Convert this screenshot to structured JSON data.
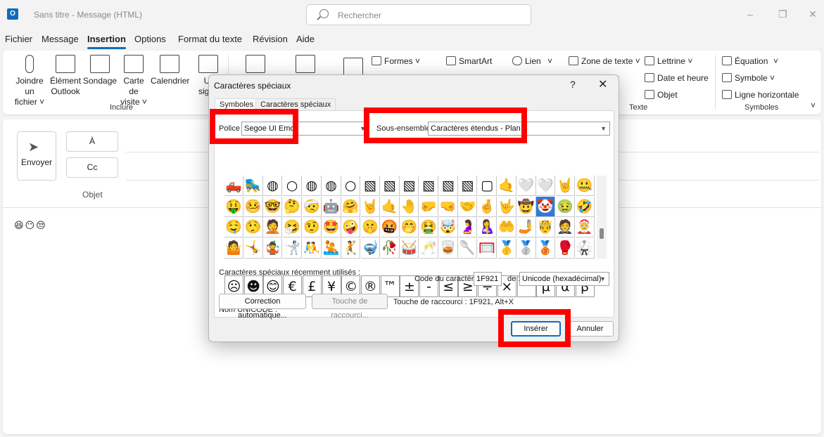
{
  "window": {
    "title": "Sans titre  -  Message (HTML)",
    "app_letter": "O"
  },
  "search": {
    "placeholder": "Rechercher"
  },
  "tabs": [
    "Fichier",
    "Message",
    "Insertion",
    "Options",
    "Format du texte",
    "Révision",
    "Aide"
  ],
  "active_tab": "Insertion",
  "ribbon": {
    "include": {
      "attach": [
        "Joindre un",
        "fichier ˅"
      ],
      "outlook_item": [
        "Élément",
        "Outlook"
      ],
      "poll": "Sondage",
      "business_card": [
        "Carte de",
        "visite ˅"
      ],
      "calendar": "Calendrier",
      "signature": [
        "U",
        "signa"
      ],
      "label": "Inclure"
    },
    "shapes": "Formes ˅",
    "smartart": "SmartArt",
    "link": "Lien",
    "link_chevron": "˅",
    "text": {
      "text_box": "Zone de texte ˅",
      "drop_cap": "Lettrine ˅",
      "date_time": "Date et heure",
      "object": "Objet",
      "label": "Texte"
    },
    "symbols": {
      "equation": "Équation",
      "equation_chevron": "˅",
      "symbol": "Symbole ˅",
      "hline": "Ligne horizontale",
      "label": "Symboles"
    },
    "collapse": "˅"
  },
  "message": {
    "send": "Envoyer",
    "to": "À",
    "cc": "Cc",
    "subject_label": "Objet",
    "body": "😆😶😒"
  },
  "dialog": {
    "title": "Caractères spéciaux",
    "help": "?",
    "close": "✕",
    "tabs": [
      "Symboles",
      "Caractères spéciaux"
    ],
    "font_label": "Police :",
    "font_value": "Segoe UI Emoji",
    "subset_label": "Sous-ensemble :",
    "subset_value": "Caractères étendus - Plan 1",
    "grid_rows": [
      [
        "🛻",
        "🛼",
        "◍",
        "○",
        "◍",
        "◍",
        "○",
        "▧",
        "▧",
        "▧",
        "▧",
        "▧",
        "▧",
        "▢",
        "🤙",
        "🤍",
        "🤍",
        "🤘",
        "🤐"
      ],
      [
        "🤑",
        "🤒",
        "🤓",
        "🤔",
        "🤕",
        "🤖",
        "🤗",
        "🤘",
        "🤙",
        "🤚",
        "🤛",
        "🤜",
        "🤝",
        "🤞",
        "🤟",
        "🤠",
        "🤡",
        "🤢",
        "🤣"
      ],
      [
        "🤤",
        "🤥",
        "🤦",
        "🤧",
        "🤨",
        "🤩",
        "🤪",
        "🤫",
        "🤬",
        "🤭",
        "🤮",
        "🤯",
        "🤰",
        "🤱",
        "🤲",
        "🤳",
        "🤴",
        "🤵",
        "🤶"
      ],
      [
        "🤷",
        "🤸",
        "🤹",
        "🤺",
        "🤼",
        "🤽",
        "🤾",
        "🤿",
        "🥀",
        "🥁",
        "🥂",
        "🥃",
        "🥄",
        "🥅",
        "🥇",
        "🥈",
        "🥉",
        "🥊",
        "🥋"
      ]
    ],
    "selected_index": [
      1,
      16
    ],
    "recent_label": "Caractères spéciaux récemment utilisés :",
    "recent": [
      "☹",
      "☻",
      "😊",
      "€",
      "£",
      "¥",
      "©",
      "®",
      "™",
      "±",
      "-",
      "≤",
      "≥",
      "÷",
      "×",
      "°",
      "μ",
      "α",
      "β"
    ],
    "unicode_name_label": "Nom UNICODE :",
    "char_code_label": "Code du caractère :",
    "char_code_value": "1F921",
    "from_label": "de :",
    "from_value": "Unicode (hexadécimal)",
    "autocorrect": "Correction automatique...",
    "shortcut_key_btn": "Touche de raccourci...",
    "shortcut_text": "Touche de raccourci : 1F921, Alt+X",
    "insert": "Insérer",
    "cancel": "Annuler"
  },
  "colors": {
    "accent": "#0f6cbd",
    "highlight": "#ff0000",
    "selected_cell": "#2a7be0"
  }
}
